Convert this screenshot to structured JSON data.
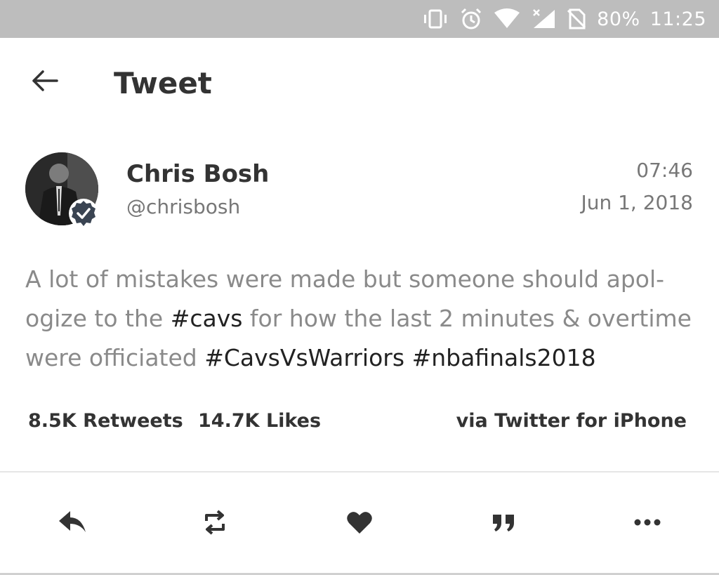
{
  "status_bar": {
    "battery": "80%",
    "time": "11:25",
    "icons": [
      "vibrate-icon",
      "alarm-icon",
      "wifi-icon",
      "signal-icon",
      "sim-off-icon"
    ]
  },
  "header": {
    "title": "Tweet",
    "back_icon": "back-arrow-icon"
  },
  "tweet": {
    "author": {
      "name": "Chris Bosh",
      "handle": "@chrisbosh",
      "verified": true
    },
    "time": "07:46",
    "date": "Jun 1, 2018",
    "text_lines": [
      {
        "plain1": "A lot of mistakes were made but someone should apol-"
      },
      {
        "plain1": "ogize to the ",
        "tag1": "#cavs",
        "plain2": " for how the last 2 minutes & overtime"
      },
      {
        "plain1": "were officiated ",
        "tag1": "#CavsVsWarriors",
        "plain2": " ",
        "tag2": "#nbafinals2018"
      }
    ],
    "stats": {
      "retweets": "8.5K Retweets",
      "likes": "14.7K Likes",
      "source": "via Twitter for iPhone"
    }
  },
  "actions": [
    "reply-icon",
    "retweet-icon",
    "like-icon",
    "quote-icon",
    "more-icon"
  ],
  "colors": {
    "status_bar": "#bdbdbd",
    "text_primary": "#333333",
    "text_secondary": "#777777",
    "tweet_text": "#8a8a8a",
    "hashtag": "#222222",
    "verified_badge": "#3a4452"
  }
}
